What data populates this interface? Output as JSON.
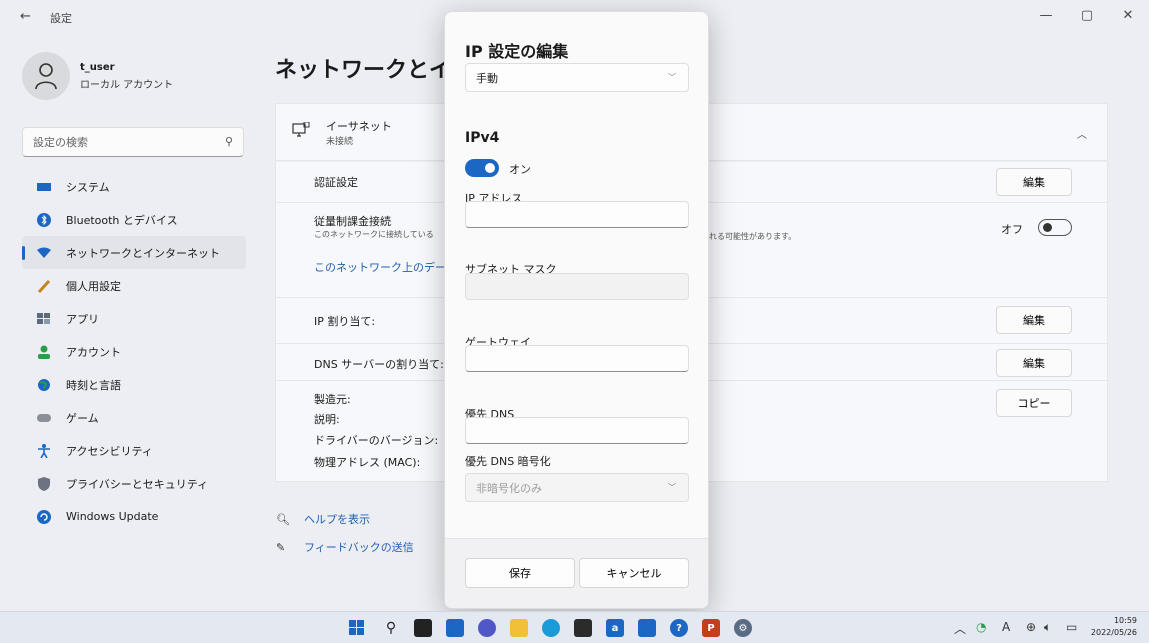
{
  "window": {
    "back_glyph": "←",
    "title": "設定",
    "minimize_glyph": "—",
    "maximize_glyph": "▢",
    "close_glyph": "✕"
  },
  "user": {
    "name": "t_user",
    "account_type": "ローカル アカウント"
  },
  "search": {
    "placeholder": "設定の検索"
  },
  "sidebar": {
    "items": [
      {
        "label": "システム",
        "icon": "system-icon",
        "color": "#1c66c4"
      },
      {
        "label": "Bluetooth とデバイス",
        "icon": "bluetooth-icon",
        "color": "#1c66c4"
      },
      {
        "label": "ネットワークとインターネット",
        "icon": "network-icon",
        "color": "#1c66c4",
        "active": true
      },
      {
        "label": "個人用設定",
        "icon": "brush-icon",
        "color": "#c7841c"
      },
      {
        "label": "アプリ",
        "icon": "apps-icon",
        "color": "#5b6a7f"
      },
      {
        "label": "アカウント",
        "icon": "account-icon",
        "color": "#2d9b4a"
      },
      {
        "label": "時刻と言語",
        "icon": "globe-icon",
        "color": "#1c66c4"
      },
      {
        "label": "ゲーム",
        "icon": "gamepad-icon",
        "color": "#8a8f98"
      },
      {
        "label": "アクセシビリティ",
        "icon": "accessibility-icon",
        "color": "#1c66c4"
      },
      {
        "label": "プライバシーとセキュリティ",
        "icon": "shield-icon",
        "color": "#6b7280"
      },
      {
        "label": "Windows Update",
        "icon": "update-icon",
        "color": "#1c66c4"
      }
    ]
  },
  "main": {
    "page_title": "ネットワークとインタ",
    "ethernet": {
      "name": "イーサネット",
      "status": "未接続"
    },
    "auth_label": "認証設定",
    "edit_label": "編集",
    "metered": {
      "label": "従量制課金接続",
      "desc_left": "このネットワークに接続している",
      "desc_right": "れる可能性があります。",
      "toggle_label": "オフ"
    },
    "data_link": "このネットワーク上のデータ(",
    "ip_assign_label": "IP 割り当て:",
    "dns_assign_label": "DNS サーバーの割り当て:",
    "properties": [
      "製造元:",
      "説明:",
      "ドライバーのバージョン:",
      "物理アドレス (MAC):"
    ],
    "copy_label": "コピー",
    "help_label": "ヘルプを表示",
    "feedback_label": "フィードバックの送信"
  },
  "dialog": {
    "title": "IP 設定の編集",
    "mode": "手動",
    "section": "IPv4",
    "toggle_label": "オン",
    "ip_label": "IP アドレス",
    "ip_value": "",
    "subnet_label": "サブネット マスク",
    "subnet_value": "",
    "gateway_label": "ゲートウェイ",
    "gateway_value": "",
    "dns_label": "優先 DNS",
    "dns_value": "",
    "dns_enc_label": "優先 DNS 暗号化",
    "dns_enc_value": "非暗号化のみ",
    "save_label": "保存",
    "cancel_label": "キャンセル"
  },
  "taskbar": {
    "time": "10:59",
    "date": "2022/05/26",
    "lang": "A"
  }
}
